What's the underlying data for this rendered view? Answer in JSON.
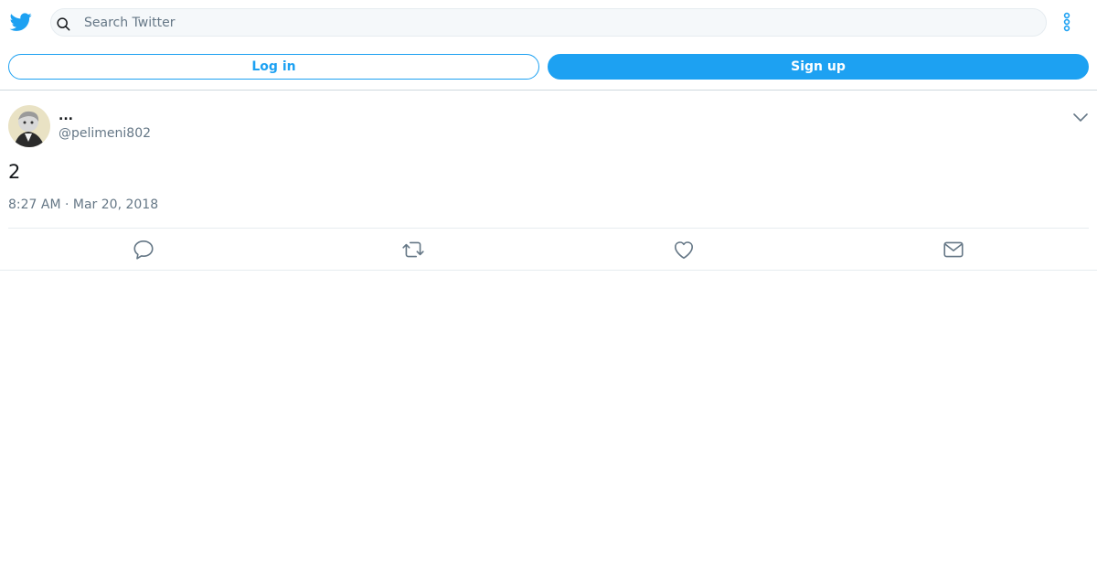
{
  "header": {
    "logo_icon": "twitter-bird-icon",
    "search": {
      "placeholder": "Search Twitter",
      "icon": "search-icon"
    },
    "menu_icon": "more-vertical-icon"
  },
  "auth": {
    "login_label": "Log in",
    "signup_label": "Sign up"
  },
  "tweet": {
    "author_name": "...",
    "author_handle": "@pelimeni802",
    "text": "2",
    "timestamp": "8:27 AM · Mar 20, 2018",
    "actions": [
      "reply-icon",
      "retweet-icon",
      "like-icon",
      "share-dm-icon"
    ]
  },
  "colors": {
    "accent": "#1da1f2",
    "muted": "#657786",
    "border": "#e6ecf0"
  }
}
